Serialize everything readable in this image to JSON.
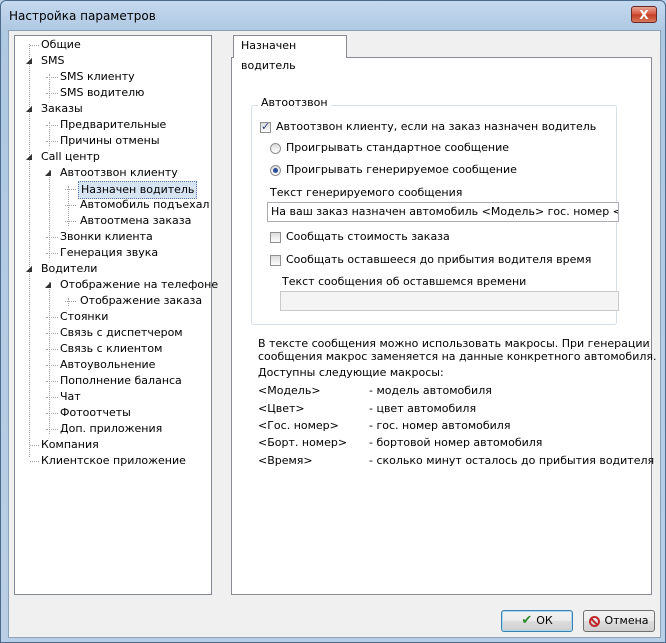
{
  "window": {
    "title": "Настройка параметров",
    "close_glyph": "X"
  },
  "tree": {
    "items": [
      {
        "label": "Общие"
      },
      {
        "label": "SMS"
      },
      {
        "label": "SMS клиенту"
      },
      {
        "label": "SMS водителю"
      },
      {
        "label": "Заказы"
      },
      {
        "label": "Предварительные"
      },
      {
        "label": "Причины отмены"
      },
      {
        "label": "Call центр"
      },
      {
        "label": "Автоотзвон клиенту"
      },
      {
        "label": "Назначен водитель"
      },
      {
        "label": "Автомобиль подъехал"
      },
      {
        "label": "Автоотмена заказа"
      },
      {
        "label": "Звонки клиента"
      },
      {
        "label": "Генерация звука"
      },
      {
        "label": "Водители"
      },
      {
        "label": "Отображение на телефоне"
      },
      {
        "label": "Отображение заказа"
      },
      {
        "label": "Стоянки"
      },
      {
        "label": "Связь с диспетчером"
      },
      {
        "label": "Связь с клиентом"
      },
      {
        "label": "Автоувольнение"
      },
      {
        "label": "Пополнение баланса"
      },
      {
        "label": "Чат"
      },
      {
        "label": "Фотоотчеты"
      },
      {
        "label": "Доп. приложения"
      },
      {
        "label": "Компания"
      },
      {
        "label": "Клиентское приложение"
      }
    ],
    "selected": "Назначен водитель"
  },
  "tab": {
    "label": "Назначен водитель"
  },
  "group": {
    "caption": "Автоотзвон",
    "autocall_checkbox": {
      "label": "Автоотзвон клиенту, если на заказ назначен водитель",
      "checked": true
    },
    "radio_standard": {
      "label": "Проигрывать стандартное сообщение",
      "selected": false
    },
    "radio_generated": {
      "label": "Проигрывать генерируемое сообщение",
      "selected": true
    },
    "message_label": "Текст генерируемого сообщения",
    "message_value": "На ваш заказ назначен автомобиль <Модель> гос. номер  <Гос. номер>",
    "cost_checkbox": {
      "label": "Сообщать стоимость заказа",
      "checked": false
    },
    "time_checkbox": {
      "label": "Сообщать оставшееся до прибытия водителя время",
      "checked": false
    },
    "time_label": "Текст сообщения об оставшемся времени",
    "time_value": ""
  },
  "help": {
    "line1": "В тексте сообщения можно использовать макросы. При генерации",
    "line2": "сообщения макрос заменяется на данные конкретного автомобиля.",
    "line3": "Доступны следующие макросы:",
    "macros": [
      {
        "key": "<Модель>",
        "desc": "- модель автомобиля"
      },
      {
        "key": "<Цвет>",
        "desc": "- цвет автомобиля"
      },
      {
        "key": "<Гос. номер>",
        "desc": "- гос. номер автомобиля"
      },
      {
        "key": "<Борт. номер>",
        "desc": "- бортовой номер автомобиля"
      },
      {
        "key": "<Время>",
        "desc": "- сколько минут осталось до прибытия водителя"
      }
    ]
  },
  "buttons": {
    "ok": "ОК",
    "cancel": "Отмена",
    "ok_icon": "checkmark-icon",
    "cancel_icon": "no-entry-icon"
  },
  "colors": {
    "selection": "#d7e4f2",
    "title_bg": "#bcd3ea",
    "close": "#c23c22"
  }
}
